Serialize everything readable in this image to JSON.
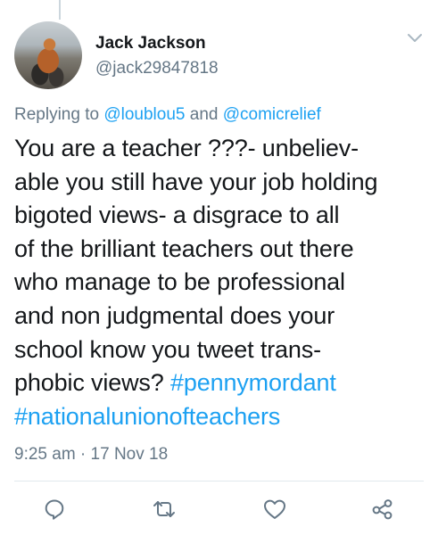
{
  "tweet": {
    "author_name": "Jack Jackson",
    "author_handle": "@jack29847818",
    "replying_prefix": "Replying to ",
    "reply_mention_1": "@loublou5",
    "reply_and": " and ",
    "reply_mention_2": "@comicrelief",
    "text_lines": [
      "You are a teacher ???- unbeliev-",
      "able you still have your job holding",
      "bigoted views- a disgrace to all",
      "of the brilliant teachers out there",
      "who manage to be professional",
      "and non judgmental does your",
      "school know you tweet trans-",
      "phobic views? "
    ],
    "hashtag_1": "#pennymordant",
    "hashtag_2": "#nationalunionofteachers",
    "timestamp": "9:25 am · 17 Nov 18"
  },
  "icons": {
    "menu": "chevron-down-icon",
    "reply": "reply-icon",
    "retweet": "retweet-icon",
    "like": "heart-icon",
    "share": "share-icon"
  },
  "colors": {
    "accent": "#1da1f2",
    "secondary_text": "#657786",
    "primary_text": "#14171a",
    "divider": "#e1e8ed"
  }
}
